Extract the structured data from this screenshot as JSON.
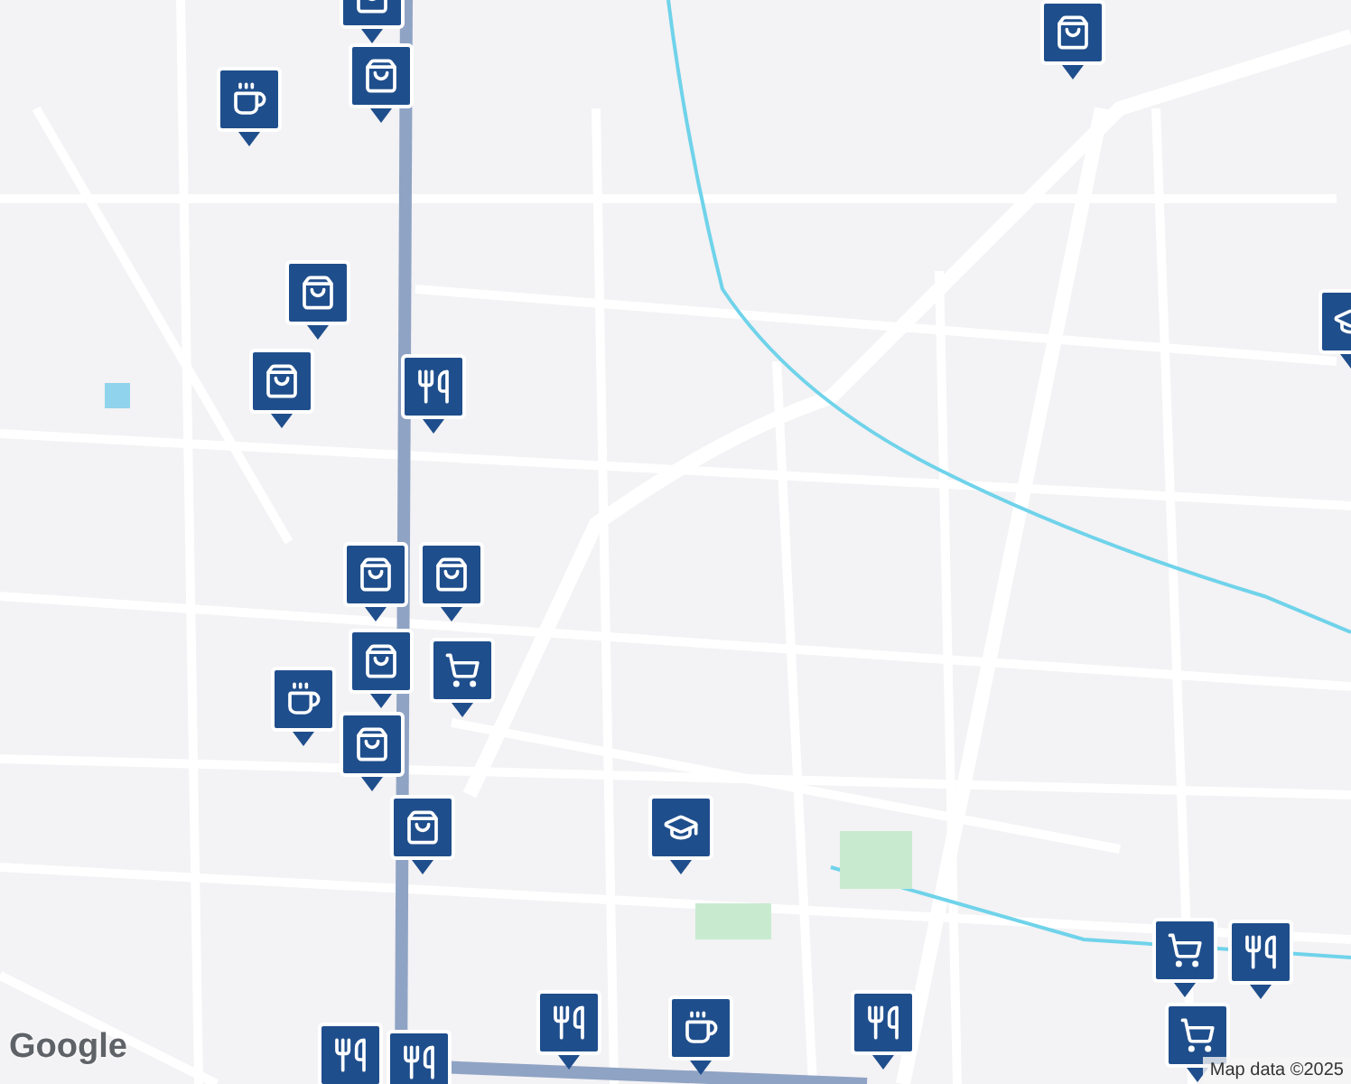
{
  "map": {
    "markers": [
      {
        "kind": "bag"
      },
      {
        "kind": "bag"
      },
      {
        "kind": "coffee"
      },
      {
        "kind": "bag"
      },
      {
        "kind": "bag"
      },
      {
        "kind": "fork"
      },
      {
        "kind": "bag"
      },
      {
        "kind": "cap"
      },
      {
        "kind": "bag"
      },
      {
        "kind": "coffee"
      },
      {
        "kind": "bag"
      },
      {
        "kind": "cart"
      },
      {
        "kind": "bag"
      },
      {
        "kind": "bag"
      },
      {
        "kind": "bag"
      },
      {
        "kind": "cap"
      },
      {
        "kind": "fork"
      },
      {
        "kind": "coffee"
      },
      {
        "kind": "fork"
      },
      {
        "kind": "fork"
      },
      {
        "kind": "cart"
      },
      {
        "kind": "cart"
      },
      {
        "kind": "fork"
      },
      {
        "kind": "fork"
      }
    ]
  },
  "logo": "Google",
  "attribution": "Map data ©2025"
}
